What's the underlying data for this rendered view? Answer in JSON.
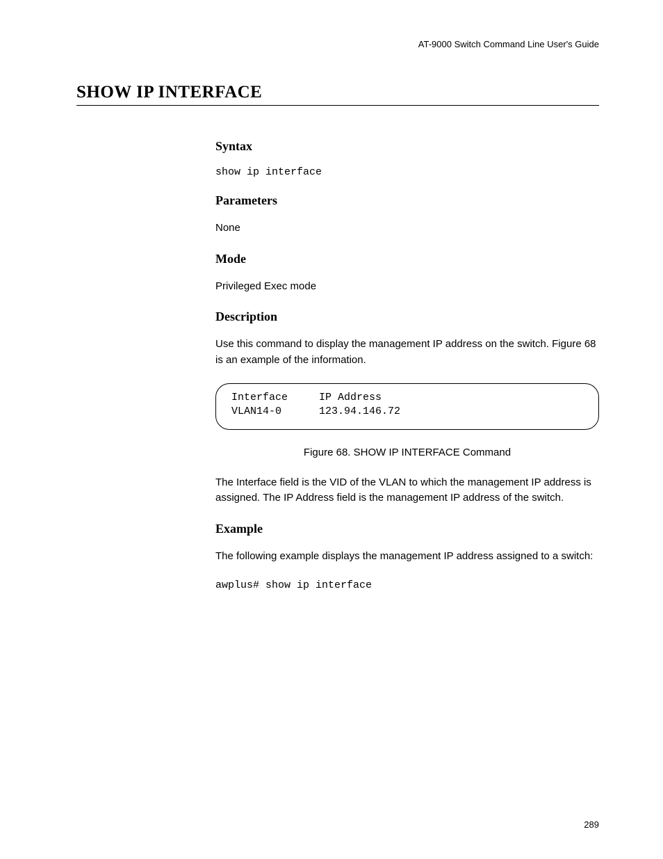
{
  "header": {
    "guide_title": "AT-9000 Switch Command Line User's Guide"
  },
  "title": "SHOW IP INTERFACE",
  "sections": {
    "syntax": {
      "heading": "Syntax",
      "command": "show ip interface"
    },
    "parameters": {
      "heading": "Parameters",
      "text": "None"
    },
    "mode": {
      "heading": "Mode",
      "text": "Privileged Exec mode"
    },
    "description": {
      "heading": "Description",
      "text1": "Use this command to display the management IP address on the switch. Figure 68 is an example of the information.",
      "output": "Interface     IP Address\nVLAN14-0      123.94.146.72",
      "caption": "Figure 68. SHOW IP INTERFACE Command",
      "text2": "The Interface field is the VID of the VLAN to which the management IP address is assigned. The IP Address field is the management IP address of the switch."
    },
    "example": {
      "heading": "Example",
      "text": "The following example displays the management IP address assigned to a switch:",
      "command": "awplus# show ip interface"
    }
  },
  "page_number": "289"
}
